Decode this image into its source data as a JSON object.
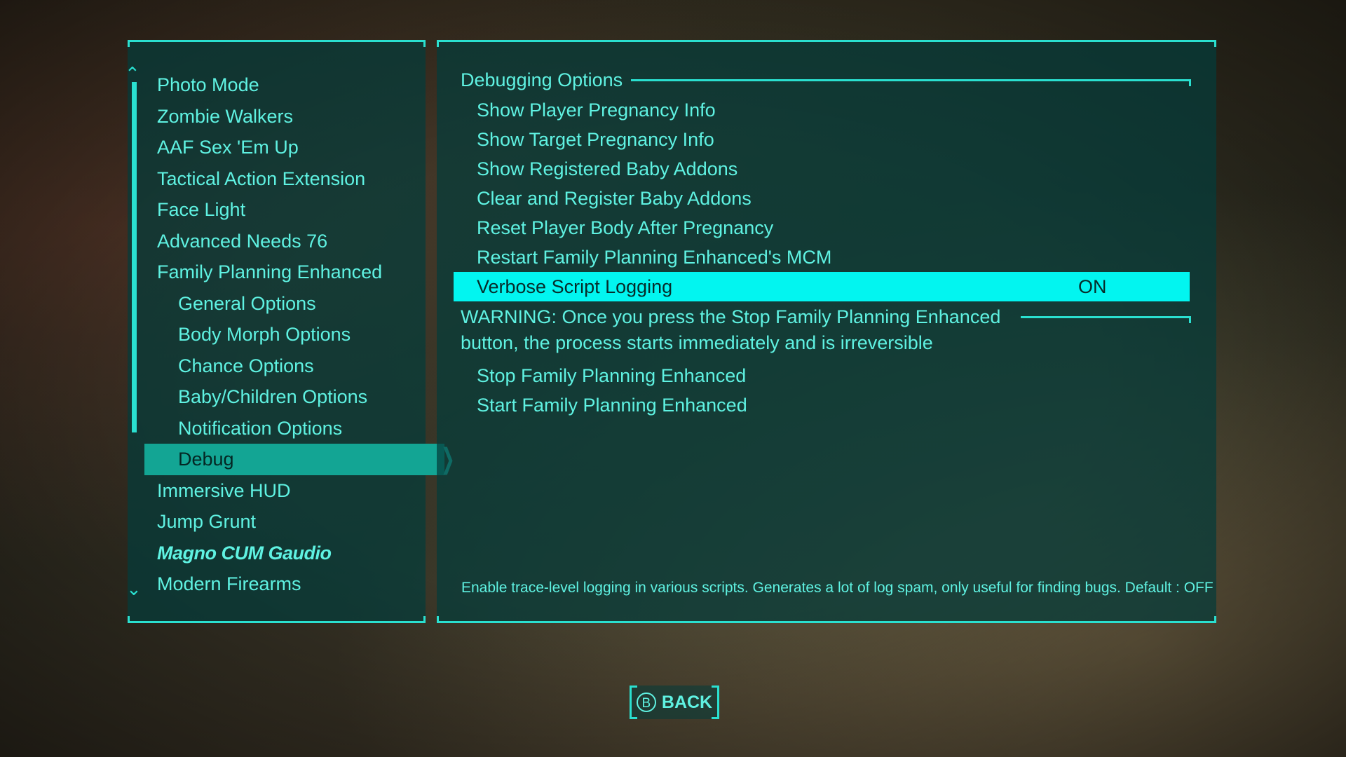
{
  "sidebar": {
    "items": [
      {
        "label": "Photo Mode"
      },
      {
        "label": "Zombie Walkers"
      },
      {
        "label": "AAF Sex 'Em Up"
      },
      {
        "label": "Tactical Action Extension"
      },
      {
        "label": "Face Light"
      },
      {
        "label": "Advanced Needs 76"
      },
      {
        "label": "Family Planning Enhanced"
      },
      {
        "label": "General Options"
      },
      {
        "label": "Body Morph Options"
      },
      {
        "label": "Chance Options"
      },
      {
        "label": "Baby/Children Options"
      },
      {
        "label": "Notification Options"
      },
      {
        "label": "Debug"
      },
      {
        "label": "Immersive HUD"
      },
      {
        "label": "Jump Grunt"
      },
      {
        "label": "Magno CUM Gaudio"
      },
      {
        "label": "Modern Firearms"
      }
    ],
    "selected": "Debug"
  },
  "main": {
    "section_title": "Debugging Options",
    "options": [
      {
        "label": "Show Player Pregnancy Info"
      },
      {
        "label": "Show Target Pregnancy Info"
      },
      {
        "label": "Show Registered Baby Addons"
      },
      {
        "label": "Clear and Register Baby Addons"
      },
      {
        "label": "Reset Player Body After Pregnancy"
      },
      {
        "label": "Restart Family Planning Enhanced's MCM"
      },
      {
        "label": "Verbose Script Logging",
        "value": "ON"
      }
    ],
    "warning": "WARNING: Once you press the Stop Family Planning Enhanced button, the process starts immediately and is irreversible",
    "options2": [
      {
        "label": "Stop Family Planning Enhanced"
      },
      {
        "label": "Start Family Planning Enhanced"
      }
    ],
    "description": "Enable trace-level logging in various scripts. Generates a lot of log spam, only useful for finding bugs.  Default : OFF"
  },
  "footer": {
    "back_key": "B",
    "back_label": "BACK"
  },
  "colors": {
    "accent": "#2ae0d0",
    "text": "#5ff2e2",
    "highlight": "#02f5f0",
    "selected_bg": "#13a594"
  }
}
